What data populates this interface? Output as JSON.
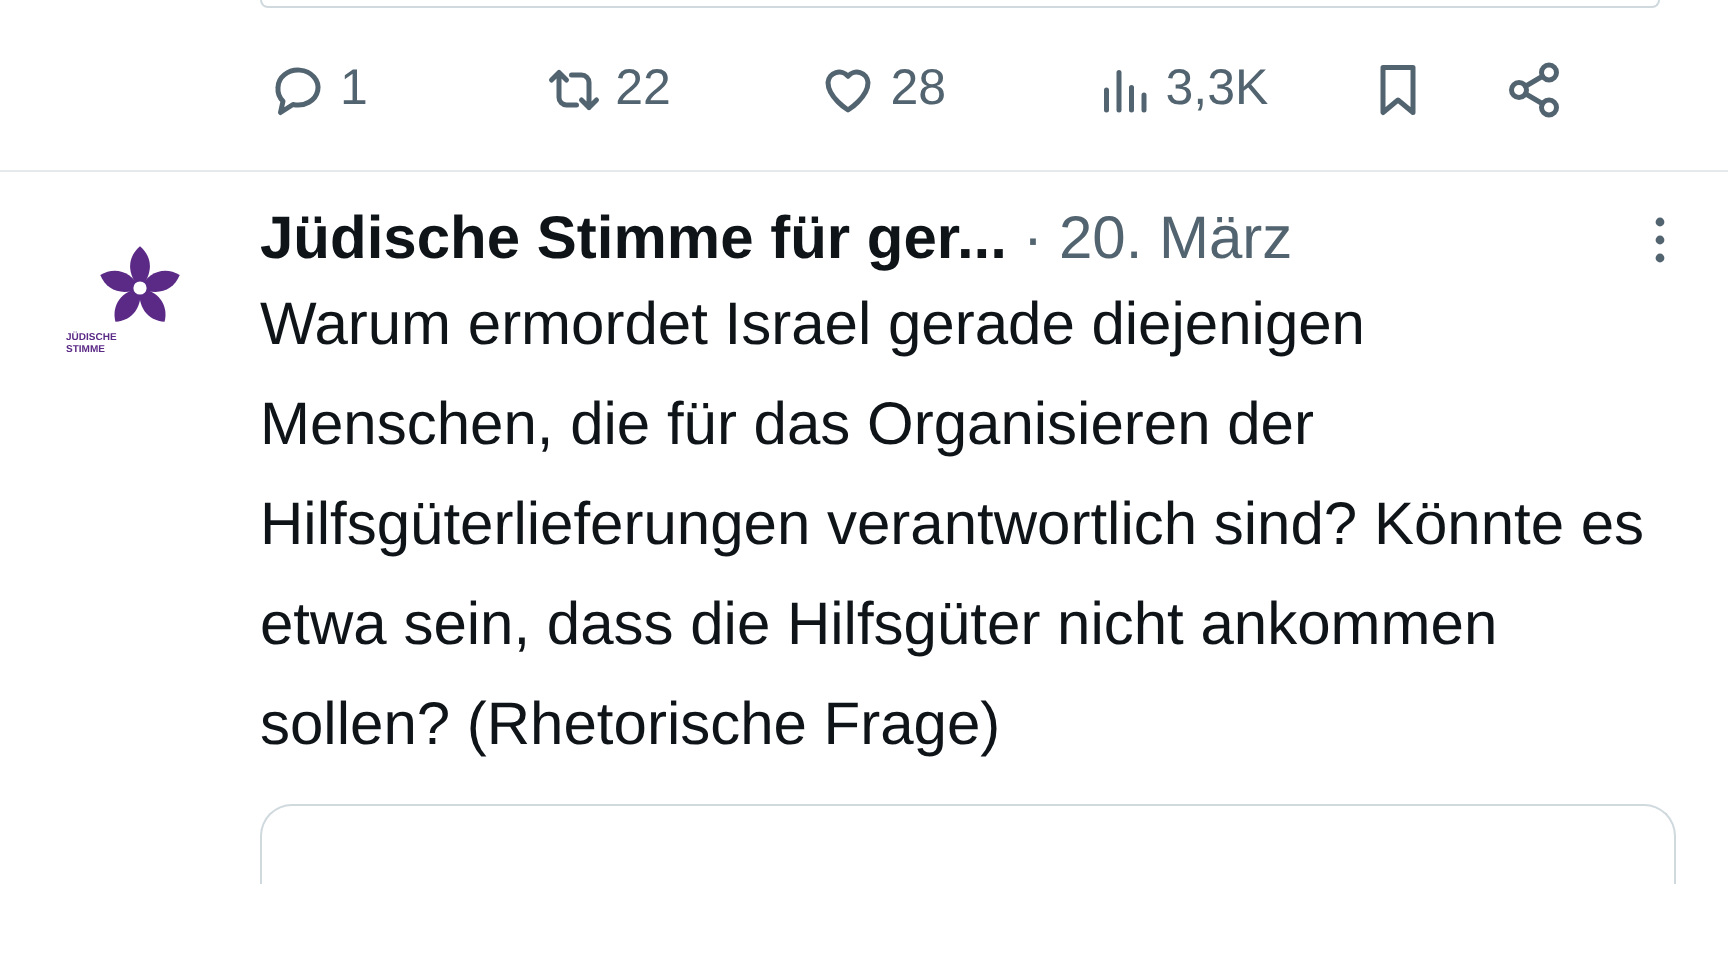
{
  "actions": [
    {
      "kind": "reply",
      "count": "1"
    },
    {
      "kind": "repost",
      "count": "22"
    },
    {
      "kind": "like",
      "count": "28"
    },
    {
      "kind": "views",
      "count": "3,3K"
    },
    {
      "kind": "bookmark"
    },
    {
      "kind": "share"
    }
  ],
  "tweet": {
    "avatar_text": [
      "JÜDISCHE",
      "STIMME"
    ],
    "author": "Jüdische Stimme für ger...",
    "separator": "·",
    "date": "20. März",
    "text": "Warum ermordet Israel gerade diejenigen Menschen, die für das Organisieren der Hilfsgüterlieferungen verantwortlich sind? Könnte es etwa sein, dass die Hilfsgüter nicht ankommen sollen? (Rhetorische Frage)"
  }
}
